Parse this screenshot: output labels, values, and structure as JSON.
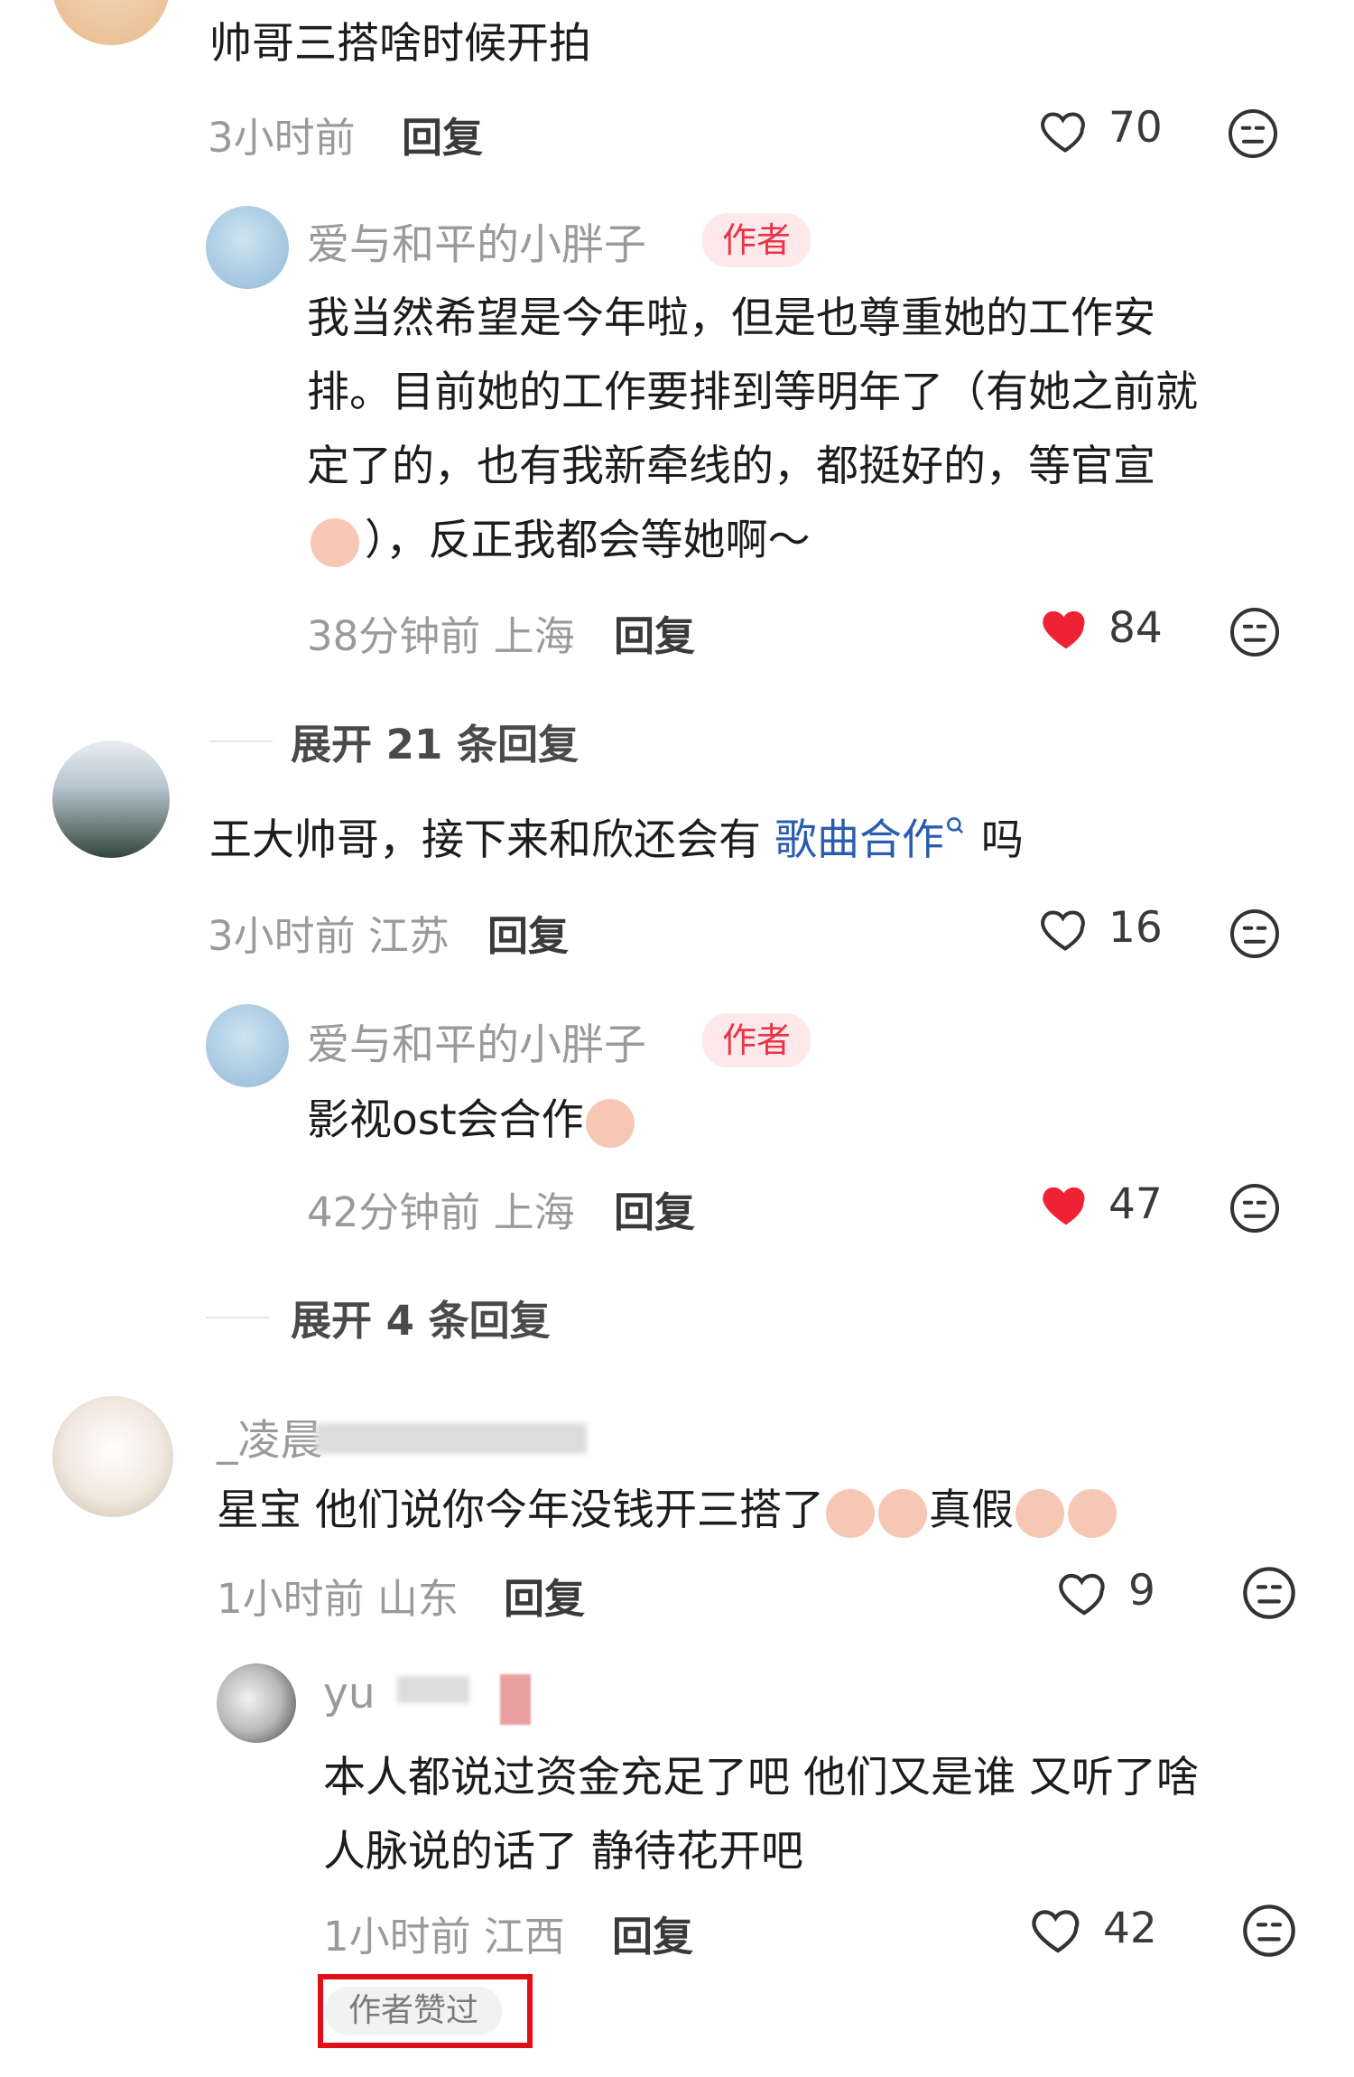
{
  "comments": [
    {
      "text": "帅哥三搭啥时候开拍",
      "time": "3小时前",
      "reply_label": "回复",
      "likes": "70",
      "liked": false,
      "reply": {
        "username": "爱与和平的小胖子",
        "badge": "作者",
        "lines": [
          "我当然希望是今年啦，但是也尊重她的工作安",
          "排。目前她的工作要排到等明年了（有她之前就",
          "定了的，也有我新牵线的，都挺好的，等官宣",
          "），反正我都会等她啊～"
        ],
        "time": "38分钟前 上海",
        "reply_label": "回复",
        "likes": "84",
        "liked": true
      },
      "expand": "展开 21 条回复"
    },
    {
      "text_pre": "王大帅哥，接下来和欣还会有 ",
      "text_link": "歌曲合作",
      "text_post": " 吗",
      "time": "3小时前 江苏",
      "reply_label": "回复",
      "likes": "16",
      "liked": false,
      "reply": {
        "username": "爱与和平的小胖子",
        "badge": "作者",
        "text": "影视ost会合作",
        "time": "42分钟前 上海",
        "reply_label": "回复",
        "likes": "47",
        "liked": true
      },
      "expand": "展开 4 条回复"
    },
    {
      "username": "_凌晨",
      "text_a": "星宝 他们说你今年没钱开三搭了",
      "text_b": "真假",
      "time": "1小时前 山东",
      "reply_label": "回复",
      "likes": "9",
      "liked": false,
      "reply": {
        "username": "yu",
        "lines": [
          "本人都说过资金充足了吧 他们又是谁 又听了啥",
          "人脉说的话了 静待花开吧"
        ],
        "time": "1小时前 江西",
        "reply_label": "回复",
        "likes": "42",
        "liked": false,
        "liked_by_author": "作者赞过"
      }
    }
  ],
  "colors": {
    "heart_red": "#ee2233",
    "link_blue": "#2a5db0",
    "highlight_box": "#e0101a"
  },
  "icons": [
    "heart-outline-icon",
    "heart-filled-icon",
    "dislike-face-icon",
    "search-small-icon"
  ]
}
